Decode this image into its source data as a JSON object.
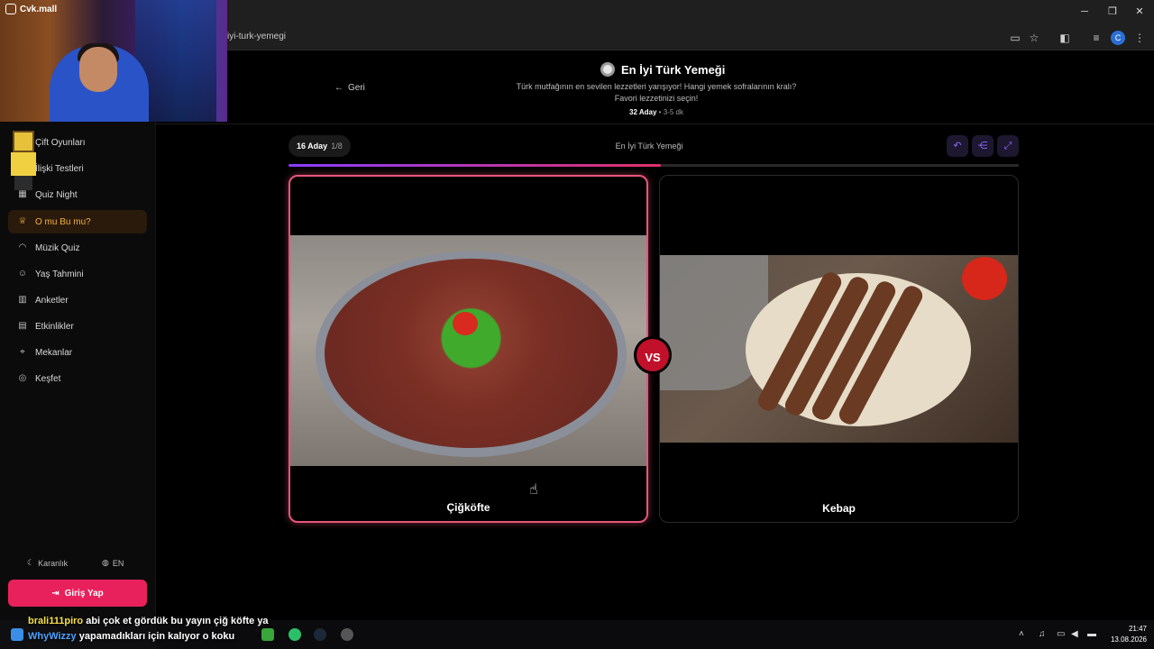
{
  "stream": {
    "channel": "Cvk.mall"
  },
  "browser": {
    "url": "iyi-turk-yemegi"
  },
  "sidebar": {
    "items": [
      {
        "label": "Çift Oyunları",
        "icon": "gamepad-icon"
      },
      {
        "label": "İlişki Testleri",
        "icon": "heart-icon"
      },
      {
        "label": "Quiz Night",
        "icon": "grid-icon"
      },
      {
        "label": "O mu Bu mu?",
        "icon": "trophy-icon",
        "active": true
      },
      {
        "label": "Müzik Quiz",
        "icon": "headphones-icon"
      },
      {
        "label": "Yaş Tahmini",
        "icon": "user-icon"
      },
      {
        "label": "Anketler",
        "icon": "bar-chart-icon"
      },
      {
        "label": "Etkinlikler",
        "icon": "calendar-icon"
      },
      {
        "label": "Mekanlar",
        "icon": "map-pin-icon"
      },
      {
        "label": "Keşfet",
        "icon": "compass-icon"
      }
    ],
    "theme_label": "Karanlık",
    "lang_label": "EN",
    "login_label": "Giriş Yap"
  },
  "page": {
    "back_label": "Geri",
    "title": "En İyi Türk Yemeği",
    "subtitle_line1": "Türk mutfağının en sevilen lezzetleri yarışıyor! Hangi yemek sofralarının kralı?",
    "subtitle_line2": "Favori lezzetinizi seçin!",
    "candidates_count": "32 Aday",
    "separator": "•",
    "duration": "3-5 dk"
  },
  "tournament": {
    "round_label": "16 Aday",
    "round_progress_text": "1/8",
    "center_label": "En İyi Türk Yemeği",
    "progress": 0.51,
    "vs_label": "VS",
    "left": {
      "name": "Çiğköfte",
      "selected": true
    },
    "right": {
      "name": "Kebap",
      "selected": false
    }
  },
  "chat": [
    {
      "user": "brali111piro",
      "message": "abi çok et gördük bu yayın çiğ köfte ya"
    },
    {
      "user": "WhyWizzy",
      "message": "yapamadıkları için kalıyor o koku"
    }
  ],
  "taskbar": {
    "time": "21:47",
    "date": "13.08.2026"
  },
  "colors": {
    "accent_pink": "#e8215c",
    "active_nav": "#f5b33a",
    "vs_red": "#c0102a",
    "tool_purple": "#8d6bff"
  }
}
